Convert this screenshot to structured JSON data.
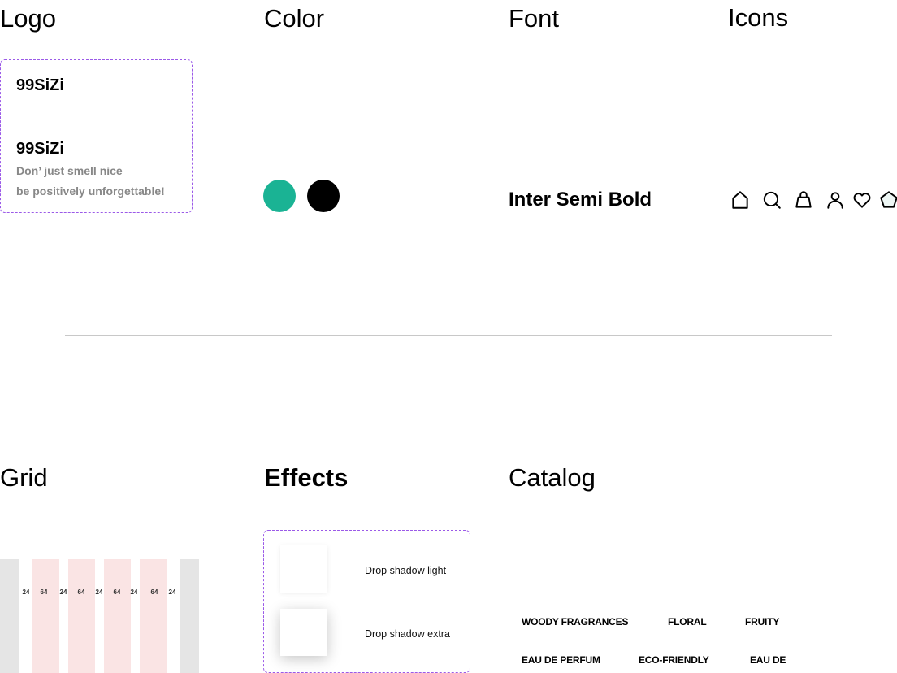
{
  "sections": {
    "logo": "Logo",
    "color": "Color",
    "font": "Font",
    "icons": "Icons",
    "grid": "Grid",
    "effects": "Effects",
    "catalog": "Catalog"
  },
  "logo": {
    "primary": "99SiZi",
    "secondary": "99SiZi",
    "tagline_1": "Don’ just smell nice",
    "tagline_2": "be positively unforgettable!"
  },
  "colors": {
    "primary": "#1ab394",
    "secondary": "#000000",
    "accent_border": "#9b5ae8"
  },
  "font": {
    "name": "Inter Semi Bold"
  },
  "icons": [
    "home-icon",
    "search-icon",
    "shopping-bag-icon",
    "user-icon",
    "heart-icon",
    "star-icon"
  ],
  "grid": {
    "labels": [
      "24",
      "64",
      "24",
      "64",
      "24",
      "64",
      "24",
      "64",
      "24"
    ]
  },
  "effects": {
    "light": "Drop shadow light",
    "extra": "Drop shadow extra"
  },
  "catalog": {
    "items": [
      "WOODY FRAGRANCES",
      "FLORAL",
      "FRUITY",
      "EAU DE PERFUM",
      "ECO-FRIENDLY",
      "EAU DE"
    ]
  }
}
